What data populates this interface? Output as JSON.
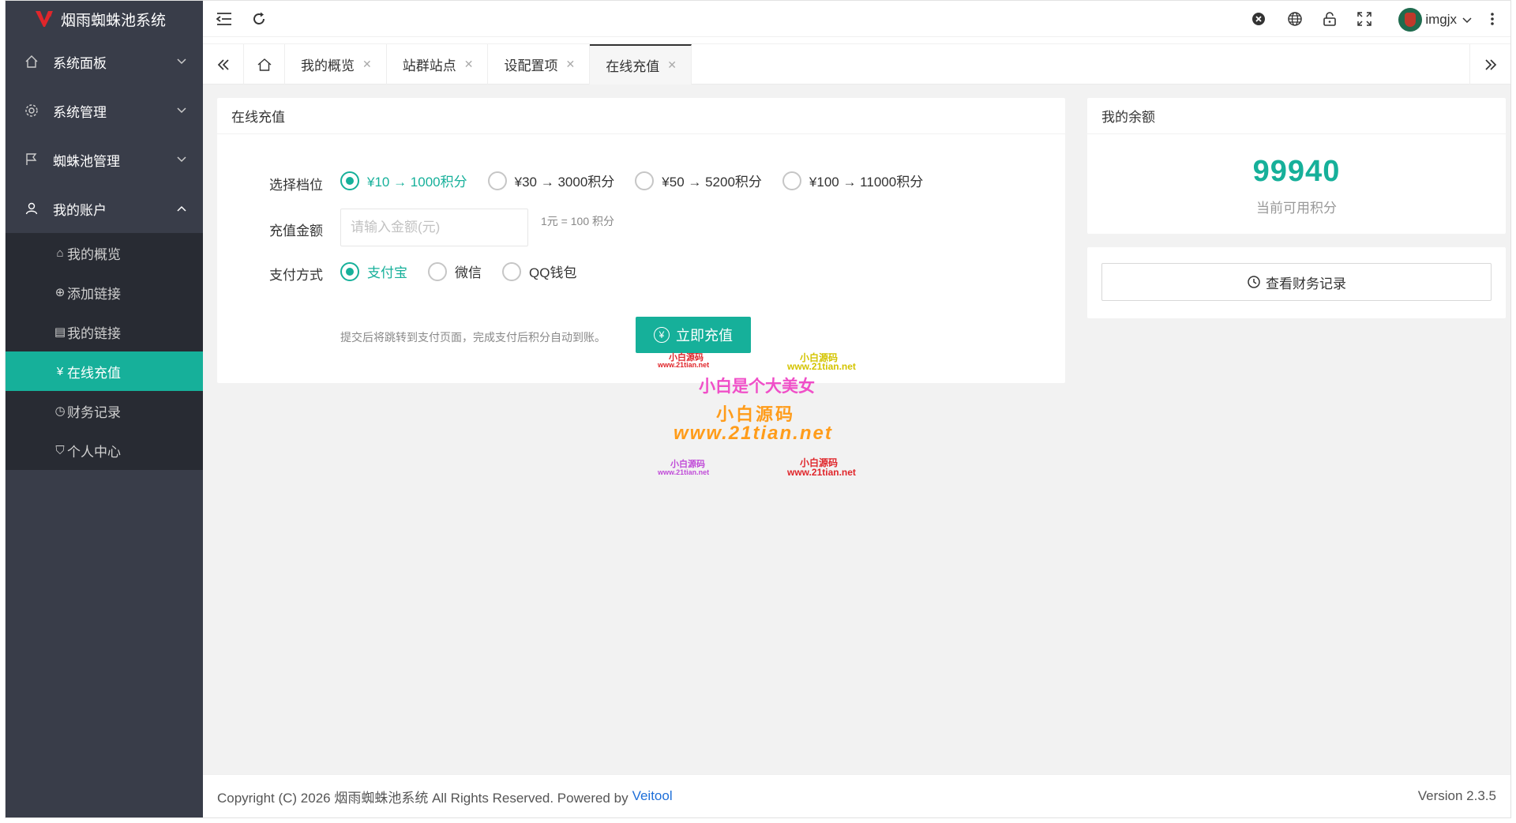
{
  "app": {
    "name": "烟雨蜘蛛池系统"
  },
  "sidebar": {
    "items": [
      {
        "label": "系统面板",
        "icon": "home-icon",
        "expanded": false
      },
      {
        "label": "系统管理",
        "icon": "gear-icon",
        "expanded": false
      },
      {
        "label": "蜘蛛池管理",
        "icon": "flag-icon",
        "expanded": false
      },
      {
        "label": "我的账户",
        "icon": "user-icon",
        "expanded": true
      }
    ],
    "sub_items": [
      {
        "label": "我的概览",
        "glyph": "⌂",
        "icon": "home-icon"
      },
      {
        "label": "添加链接",
        "glyph": "⊕",
        "icon": "plus-circle-icon"
      },
      {
        "label": "我的链接",
        "glyph": "▤",
        "icon": "document-icon"
      },
      {
        "label": "在线充值",
        "glyph": "¥",
        "icon": "yen-icon",
        "active": true
      },
      {
        "label": "财务记录",
        "glyph": "◷",
        "icon": "clock-icon"
      },
      {
        "label": "个人中心",
        "glyph": "⛉",
        "icon": "shield-icon"
      }
    ]
  },
  "header": {
    "username": "imgjx"
  },
  "tabs": [
    {
      "label": "我的概览"
    },
    {
      "label": "站群站点"
    },
    {
      "label": "设配置项"
    },
    {
      "label": "在线充值",
      "active": true
    }
  ],
  "recharge": {
    "title": "在线充值",
    "tier_label": "选择档位",
    "tiers": [
      "¥10 → 1000积分",
      "¥30 → 3000积分",
      "¥50 → 5200积分",
      "¥100 → 11000积分"
    ],
    "amount_label": "充值金额",
    "amount_placeholder": "请输入金额(元)",
    "rate_hint": "1元 = 100 积分",
    "payment_label": "支付方式",
    "payment_methods": [
      "支付宝",
      "微信",
      "QQ钱包"
    ],
    "submit_hint": "提交后将跳转到支付页面，完成支付后积分自动到账。",
    "submit_label": "立即充值"
  },
  "balance": {
    "title": "我的余额",
    "value": "99940",
    "caption": "当前可用积分"
  },
  "finance_button": {
    "label": "查看财务记录"
  },
  "watermark": {
    "line_main": "小白是个大美女",
    "line_brand": "小白源码",
    "line_url": "www.21tian.net",
    "small_brand": "小白源码",
    "small_url": "www.21tian.net"
  },
  "footer": {
    "copyright": "Copyright (C) 2026 烟雨蜘蛛池系统 All Rights Reserved. Powered by",
    "link": "Veitool",
    "version": "Version 2.3.5"
  },
  "colors": {
    "accent": "#16b09a",
    "sidebar": "#393d49",
    "sidebar_sub": "#282b33",
    "link": "#1e6fd9"
  }
}
